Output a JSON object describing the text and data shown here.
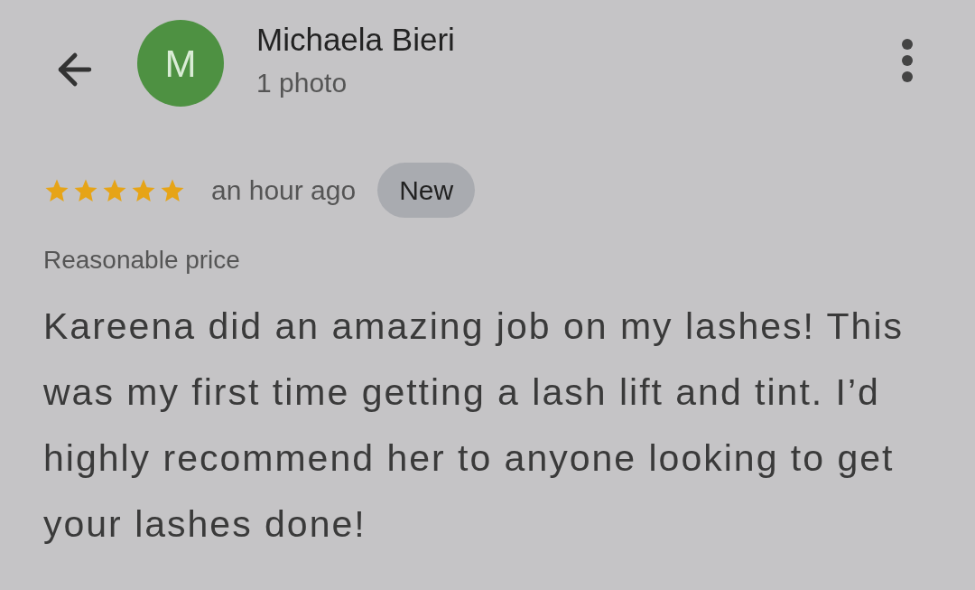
{
  "reviewer": {
    "initial": "M",
    "name": "Michaela Bieri",
    "subtitle": "1 photo"
  },
  "review": {
    "stars": 5,
    "time": "an hour ago",
    "badge": "New",
    "tag": "Reasonable price",
    "text": "Kareena did an amazing job on my lashes! This was my first time getting a lash lift and tint. I’d highly recommend her to anyone looking to get your lashes done!"
  }
}
